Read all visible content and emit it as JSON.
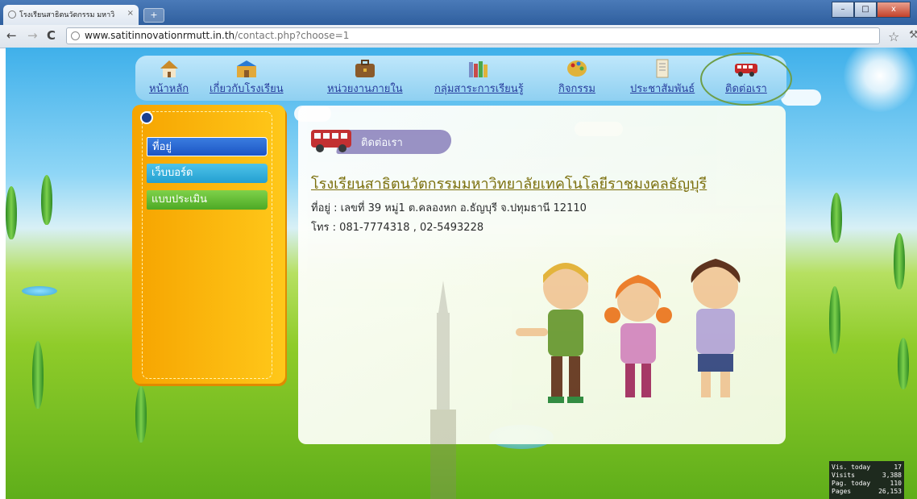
{
  "browser": {
    "tab_title": "โรงเรียนสาธิตนวัตกรรม มหาวิ",
    "tab_close": "×",
    "new_tab": "+",
    "url_host": "www.satitinnovationrmutt.in.th",
    "url_path": "/contact.php?choose=1",
    "back": "←",
    "forward": "→",
    "reload": "C",
    "star": "☆",
    "menu": "⚒",
    "minimize": "–",
    "maximize": "□",
    "close": "x"
  },
  "nav": {
    "items": [
      {
        "label": "หน้าหลัก",
        "icon": "house-icon",
        "color": "#c98a2a"
      },
      {
        "label": "เกี่ยวกับโรงเรียน",
        "icon": "school-icon",
        "color": "#e2a93a"
      },
      {
        "label": "หน่วยงานภายใน",
        "icon": "briefcase-icon",
        "color": "#8a5a2a"
      },
      {
        "label": "กลุ่มสาระการเรียนรู้",
        "icon": "books-icon",
        "color": "#7a8fc8"
      },
      {
        "label": "กิจกรรม",
        "icon": "palette-icon",
        "color": "#e0b23a"
      },
      {
        "label": "ประชาสัมพันธ์",
        "icon": "paper-icon",
        "color": "#d9c9a0"
      },
      {
        "label": "ติดต่อเรา",
        "icon": "bus-icon",
        "color": "#c62828"
      }
    ],
    "active": "ติดต่อเรา"
  },
  "sidebar": {
    "items": [
      {
        "label": "ที่อยู่"
      },
      {
        "label": "เว็บบอร์ด"
      },
      {
        "label": "แบบประเมิน"
      }
    ]
  },
  "content": {
    "banner_label": "ติดต่อเรา",
    "school_name": "โรงเรียนสาธิตนวัตกรรมมหาวิทยาลัยเทคโนโลยีราชมงคลธัญบุรี",
    "address": "ที่อยู่ : เลขที่ 39 หมู่1 ต.คลองหก อ.ธัญบุรี จ.ปทุมธานี 12110",
    "phone": "โทร : 081-7774318 , 02-5493228"
  },
  "stats": {
    "rows": [
      {
        "label": "Vis. today",
        "value": "17"
      },
      {
        "label": "Visits",
        "value": "3,388"
      },
      {
        "label": "Pag. today",
        "value": "110"
      },
      {
        "label": "Pages",
        "value": "26,153"
      }
    ]
  },
  "colors": {
    "accent_nav": "#2a3f9e",
    "sidebar": "#ffb300",
    "school_name": "#7a6a00"
  }
}
